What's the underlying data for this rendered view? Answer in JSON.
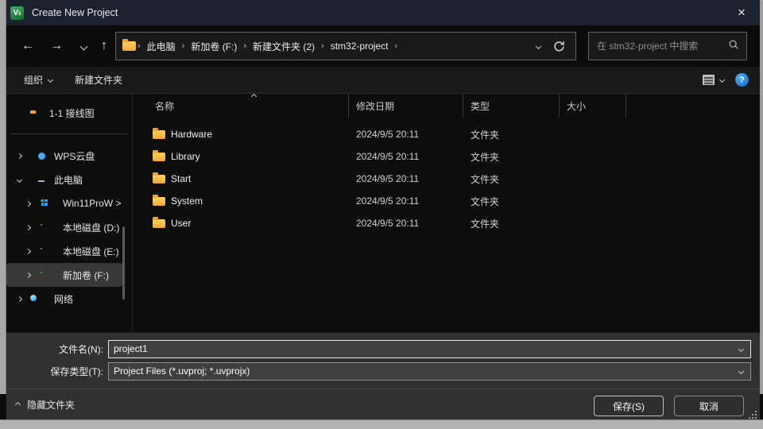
{
  "window": {
    "title": "Create New Project"
  },
  "icons": {
    "app_badge": "V",
    "app_badge_sub": "5",
    "close": "×",
    "back": "←",
    "forward": "→",
    "up": "↑",
    "help": "?",
    "crumb_sep": "›"
  },
  "nav": {
    "breadcrumb": [
      "此电脑",
      "新加卷 (F:)",
      "新建文件夹 (2)",
      "stm32-project"
    ],
    "search_placeholder": "在 stm32-project 中搜索"
  },
  "toolbar": {
    "organize": "组织",
    "new_folder": "新建文件夹"
  },
  "sidebar": {
    "pinned": {
      "label": "1-1 接线图"
    },
    "items": [
      {
        "label": "WPS云盘"
      },
      {
        "label": "此电脑"
      },
      {
        "label": "Win11ProW >"
      },
      {
        "label": "本地磁盘 (D:)"
      },
      {
        "label": "本地磁盘 (E:)"
      },
      {
        "label": "新加卷 (F:)"
      },
      {
        "label": "网络"
      }
    ]
  },
  "list": {
    "columns": [
      "名称",
      "修改日期",
      "类型",
      "大小"
    ],
    "rows": [
      {
        "name": "Hardware",
        "date": "2024/9/5 20:11",
        "type": "文件夹",
        "size": ""
      },
      {
        "name": "Library",
        "date": "2024/9/5 20:11",
        "type": "文件夹",
        "size": ""
      },
      {
        "name": "Start",
        "date": "2024/9/5 20:11",
        "type": "文件夹",
        "size": ""
      },
      {
        "name": "System",
        "date": "2024/9/5 20:11",
        "type": "文件夹",
        "size": ""
      },
      {
        "name": "User",
        "date": "2024/9/5 20:11",
        "type": "文件夹",
        "size": ""
      }
    ]
  },
  "form": {
    "filename_label": "文件名(N):",
    "filename_value": "project1",
    "filetype_label": "保存类型(T):",
    "filetype_value": "Project Files (*.uvproj; *.uvprojx)"
  },
  "actions": {
    "save": "保存(S)",
    "cancel": "取消",
    "hide_folders": "隐藏文件夹"
  },
  "colors": {
    "titlebar": "#1c2130",
    "help_blue": "#2488d8",
    "folder_yellow": "#f3c04a",
    "selection": "#383838"
  }
}
